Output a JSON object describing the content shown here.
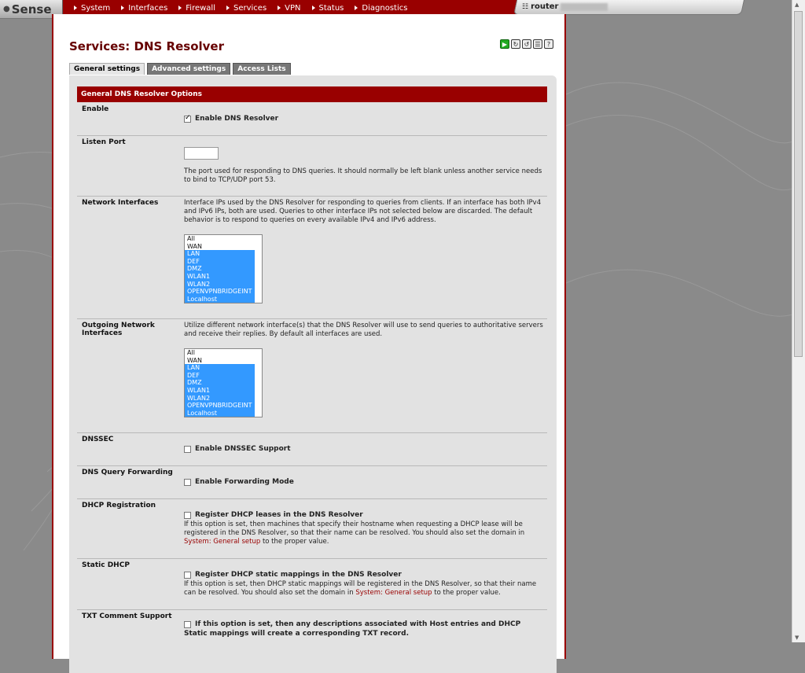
{
  "app": {
    "logo": "Sense",
    "hostname": "router"
  },
  "nav": [
    "System",
    "Interfaces",
    "Firewall",
    "Services",
    "VPN",
    "Status",
    "Diagnostics"
  ],
  "page": {
    "title": "Services: DNS Resolver",
    "title_icons": [
      "play-icon",
      "restart-icon",
      "log-icon",
      "list-icon",
      "help-icon"
    ]
  },
  "tabs": [
    "General settings",
    "Advanced settings",
    "Access Lists"
  ],
  "section_title": "General DNS Resolver Options",
  "enable": {
    "label": "Enable",
    "checkbox_label": "Enable DNS Resolver",
    "checked": true
  },
  "listen_port": {
    "label": "Listen Port",
    "value": "",
    "desc": "The port used for responding to DNS queries. It should normally be left blank unless another service needs to bind to TCP/UDP port 53."
  },
  "network_interfaces": {
    "label": "Network Interfaces",
    "desc": "Interface IPs used by the DNS Resolver for responding to queries from clients. If an interface has both IPv4 and IPv6 IPs, both are used. Queries to other interface IPs not selected below are discarded. The default behavior is to respond to queries on every available IPv4 and IPv6 address.",
    "options": [
      "All",
      "WAN",
      "LAN",
      "DEF",
      "DMZ",
      "WLAN1",
      "WLAN2",
      "OPENVPNBRIDGEINT",
      "Localhost"
    ],
    "selected": [
      "LAN",
      "DEF",
      "DMZ",
      "WLAN1",
      "WLAN2",
      "OPENVPNBRIDGEINT",
      "Localhost"
    ]
  },
  "outgoing_interfaces": {
    "label": "Outgoing Network Interfaces",
    "desc": "Utilize different network interface(s) that the DNS Resolver will use to send queries to authoritative servers and receive their replies. By default all interfaces are used.",
    "options": [
      "All",
      "WAN",
      "LAN",
      "DEF",
      "DMZ",
      "WLAN1",
      "WLAN2",
      "OPENVPNBRIDGEINT",
      "Localhost"
    ],
    "selected": [
      "LAN",
      "DEF",
      "DMZ",
      "WLAN1",
      "WLAN2",
      "OPENVPNBRIDGEINT",
      "Localhost"
    ]
  },
  "dnssec": {
    "label": "DNSSEC",
    "checkbox_label": "Enable DNSSEC Support",
    "checked": false
  },
  "forwarding": {
    "label": "DNS Query Forwarding",
    "checkbox_label": "Enable Forwarding Mode",
    "checked": false
  },
  "dhcp_registration": {
    "label": "DHCP Registration",
    "checkbox_label": "Register DHCP leases in the DNS Resolver",
    "checked": false,
    "desc_pre": "If this option is set, then machines that specify their hostname when requesting a DHCP lease will be registered in the DNS Resolver, so that their name can be resolved. You should also set the domain in ",
    "link": "System: General setup",
    "desc_post": " to the proper value."
  },
  "static_dhcp": {
    "label": "Static DHCP",
    "checkbox_label": "Register DHCP static mappings in the DNS Resolver",
    "checked": false,
    "desc_pre": "If this option is set, then DHCP static mappings will be registered in the DNS Resolver, so that their name can be resolved. You should also set the domain in ",
    "link": "System: General setup",
    "desc_post": " to the proper value."
  },
  "txt_comment": {
    "label": "TXT Comment Support",
    "checkbox_label": "If this option is set, then any descriptions associated with Host entries and DHCP Static mappings will create a corresponding TXT record.",
    "checked": false
  }
}
